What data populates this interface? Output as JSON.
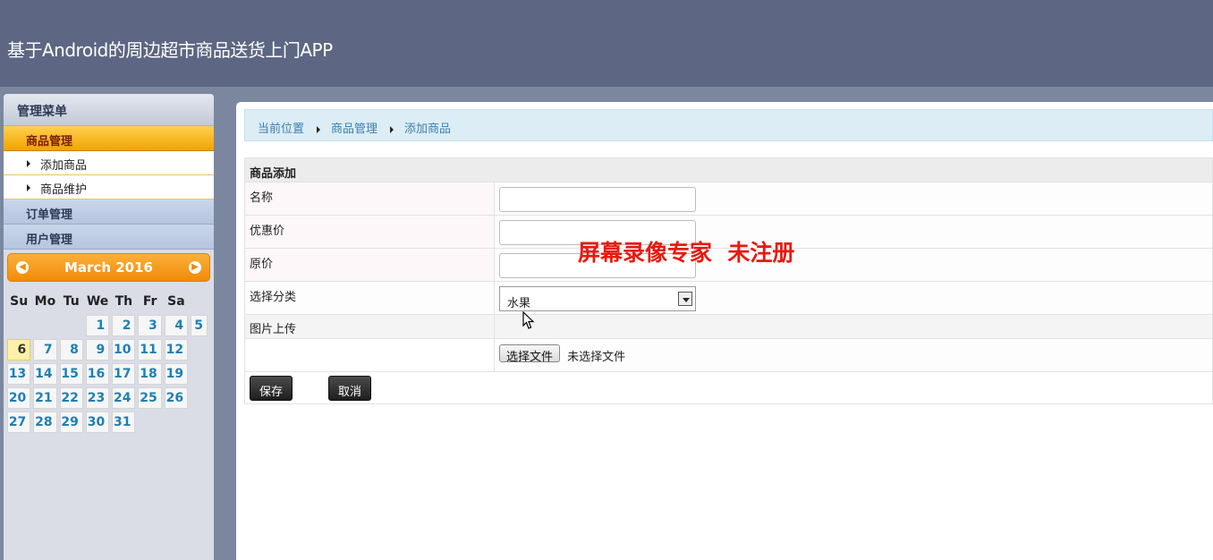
{
  "header": {
    "title": "基于Android的周边超市商品送货上门APP"
  },
  "sidebar": {
    "title": "管理菜单",
    "groups": [
      {
        "label": "商品管理",
        "items": [
          "添加商品",
          "商品维护"
        ]
      },
      {
        "label": "订单管理"
      },
      {
        "label": "用户管理"
      }
    ]
  },
  "calendar": {
    "month_label": "March 2016",
    "weekdays": [
      "Su",
      "Mo",
      "Tu",
      "We",
      "Th",
      "Fr",
      "Sa"
    ],
    "weeks": [
      [
        "",
        "",
        "",
        "1",
        "2",
        "3",
        "4",
        "5"
      ],
      [
        "6",
        "7",
        "8",
        "9",
        "10",
        "11",
        "12"
      ],
      [
        "13",
        "14",
        "15",
        "16",
        "17",
        "18",
        "19"
      ],
      [
        "20",
        "21",
        "22",
        "23",
        "24",
        "25",
        "26"
      ],
      [
        "27",
        "28",
        "29",
        "30",
        "31"
      ]
    ],
    "today": "6"
  },
  "breadcrumb": [
    "当前位置",
    "商品管理",
    "添加商品"
  ],
  "form": {
    "title": "商品添加",
    "fields": [
      {
        "label": "名称",
        "value": ""
      },
      {
        "label": "优惠价",
        "value": ""
      },
      {
        "label": "原价",
        "value": ""
      }
    ],
    "category": {
      "label": "选择分类",
      "value": "水果"
    },
    "image": {
      "label": "图片上传",
      "button": "选择文件",
      "status": "未选择文件"
    },
    "save_label": "保存",
    "cancel_label": "取消"
  },
  "watermark": "屏幕录像专家  未注册"
}
